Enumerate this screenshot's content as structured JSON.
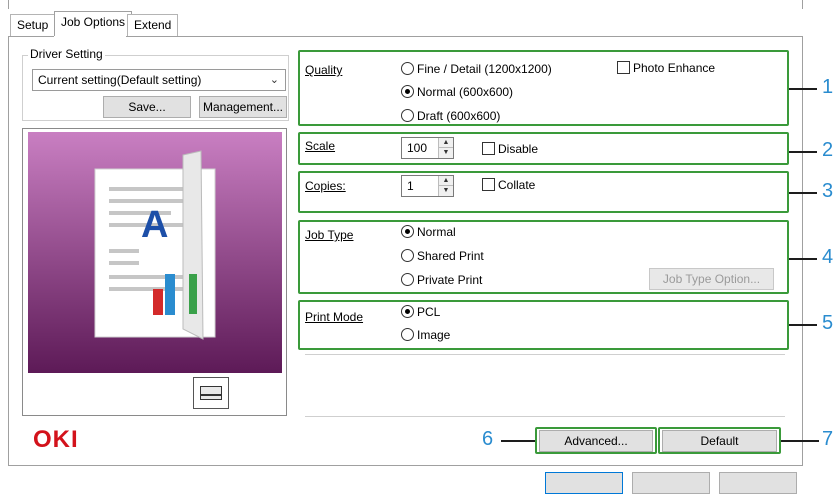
{
  "tabs": [
    {
      "label": "Setup"
    },
    {
      "label": "Job Options"
    },
    {
      "label": "Extend"
    }
  ],
  "driver_setting": {
    "title": "Driver Setting",
    "selected": "Current setting(Default setting)",
    "save_label": "Save...",
    "management_label": "Management..."
  },
  "quality": {
    "label": "Quality",
    "options": [
      "Fine / Detail (1200x1200)",
      "Normal (600x600)",
      "Draft (600x600)"
    ],
    "selected_index": 1,
    "photo_enhance": "Photo Enhance"
  },
  "scale": {
    "label": "Scale",
    "value": "100",
    "disable_label": "Disable"
  },
  "copies": {
    "label": "Copies:",
    "value": "1",
    "collate_label": "Collate"
  },
  "job_type": {
    "label": "Job Type",
    "options": [
      "Normal",
      "Shared Print",
      "Private Print"
    ],
    "selected_index": 0,
    "option_button": "Job Type Option..."
  },
  "print_mode": {
    "label": "Print Mode",
    "options": [
      "PCL",
      "Image"
    ],
    "selected_index": 0
  },
  "footer": {
    "brand": "OKI",
    "advanced_label": "Advanced...",
    "default_label": "Default"
  },
  "callouts": [
    "1",
    "2",
    "3",
    "4",
    "5",
    "6",
    "7"
  ],
  "colors": {
    "highlight": "#3a9a3a",
    "callout_number": "#2a8ccf",
    "brand": "#d3121b",
    "preview_top": "#c97fc2",
    "preview_bottom": "#5d1a57"
  }
}
